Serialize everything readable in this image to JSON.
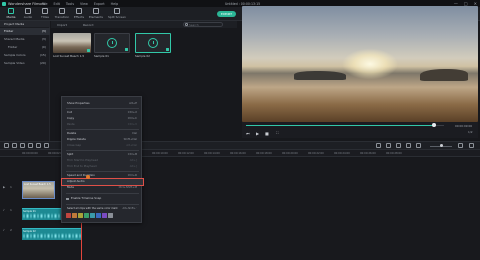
{
  "app": {
    "title": "Wondershare Filmora",
    "menu": [
      "File",
      "Edit",
      "Tools",
      "View",
      "Export",
      "Help"
    ],
    "document": "Untitled : 00:00:13:15",
    "window_controls": [
      "—",
      "□",
      "✕"
    ]
  },
  "toolbar": {
    "items": [
      "Media",
      "Audio",
      "Titles",
      "Transition",
      "Effects",
      "Elements",
      "Split Screen"
    ],
    "export_label": "EXPORT"
  },
  "left_panel": {
    "header": "Project Media",
    "items": [
      {
        "label": "Folder",
        "count": "(3)"
      },
      {
        "label": "Shared Media",
        "count": "(3)"
      },
      {
        "label": "Folder",
        "count": "(0)"
      },
      {
        "label": "Sample Colors",
        "count": "(15)"
      },
      {
        "label": "Sample Video",
        "count": "(20)"
      }
    ]
  },
  "media": {
    "tabs": [
      "Import",
      "Record"
    ],
    "search_placeholder": "Search",
    "thumbnails": [
      {
        "label": "Lost Sunset Beach 1.5"
      },
      {
        "label": "Sample 01"
      },
      {
        "label": "Sample 02"
      }
    ]
  },
  "preview": {
    "timecode": "00:00:09:06",
    "ratio": "1/2",
    "progress": 0.95
  },
  "timeline": {
    "ruler": [
      "00:00:00:00",
      "00:00:02:00",
      "00:00:04:00",
      "00:00:06:00",
      "00:00:08:00",
      "00:00:10:00",
      "00:00:12:00",
      "00:00:14:00",
      "00:00:16:00",
      "00:00:18:00",
      "00:00:20:00",
      "00:00:22:00",
      "00:00:24:00",
      "00:00:26:00",
      "00:00:28:00"
    ],
    "video_clip": "Lost Sunset Beach 1.5",
    "audio_clips": [
      "Sample 01",
      "Sample 02"
    ],
    "track_heads": [
      "1",
      "1",
      "2"
    ]
  },
  "context_menu": {
    "items": [
      {
        "label": "Show Properties",
        "key": "Alt+E",
        "disabled": false
      },
      {
        "label": "Cut",
        "key": "Ctrl+X",
        "disabled": false
      },
      {
        "label": "Copy",
        "key": "Ctrl+C",
        "disabled": false
      },
      {
        "label": "Paste",
        "key": "Ctrl+V",
        "disabled": true
      },
      {
        "label": "Delete",
        "key": "Del",
        "disabled": false
      },
      {
        "label": "Ripple Delete",
        "key": "Shift+Del",
        "disabled": false
      },
      {
        "label": "Close Gap",
        "key": "Alt+Del",
        "disabled": true
      },
      {
        "label": "Split",
        "key": "Ctrl+B",
        "disabled": false
      },
      {
        "label": "Trim Start to Playhead",
        "key": "Alt+[",
        "disabled": true
      },
      {
        "label": "Trim End to Playhead",
        "key": "Alt+]",
        "disabled": true
      },
      {
        "label": "Speed and Duration",
        "key": "Ctrl+R",
        "disabled": false
      },
      {
        "label": "Adjust Audio",
        "key": "",
        "disabled": false
      },
      {
        "label": "Mute",
        "key": "Ctrl+Shift+M",
        "disabled": false
      },
      {
        "label": "Enable Timeline Snap",
        "key": "",
        "disabled": false
      },
      {
        "label": "Select all clips with the same color mark",
        "key": "Alt+Shift+`",
        "disabled": false
      }
    ],
    "color_swatches": [
      "#c0463f",
      "#c07a3a",
      "#a9a33a",
      "#3aa06a",
      "#3a9aa9",
      "#3a6ac0",
      "#7a4ac0",
      "#8a8f97"
    ]
  }
}
